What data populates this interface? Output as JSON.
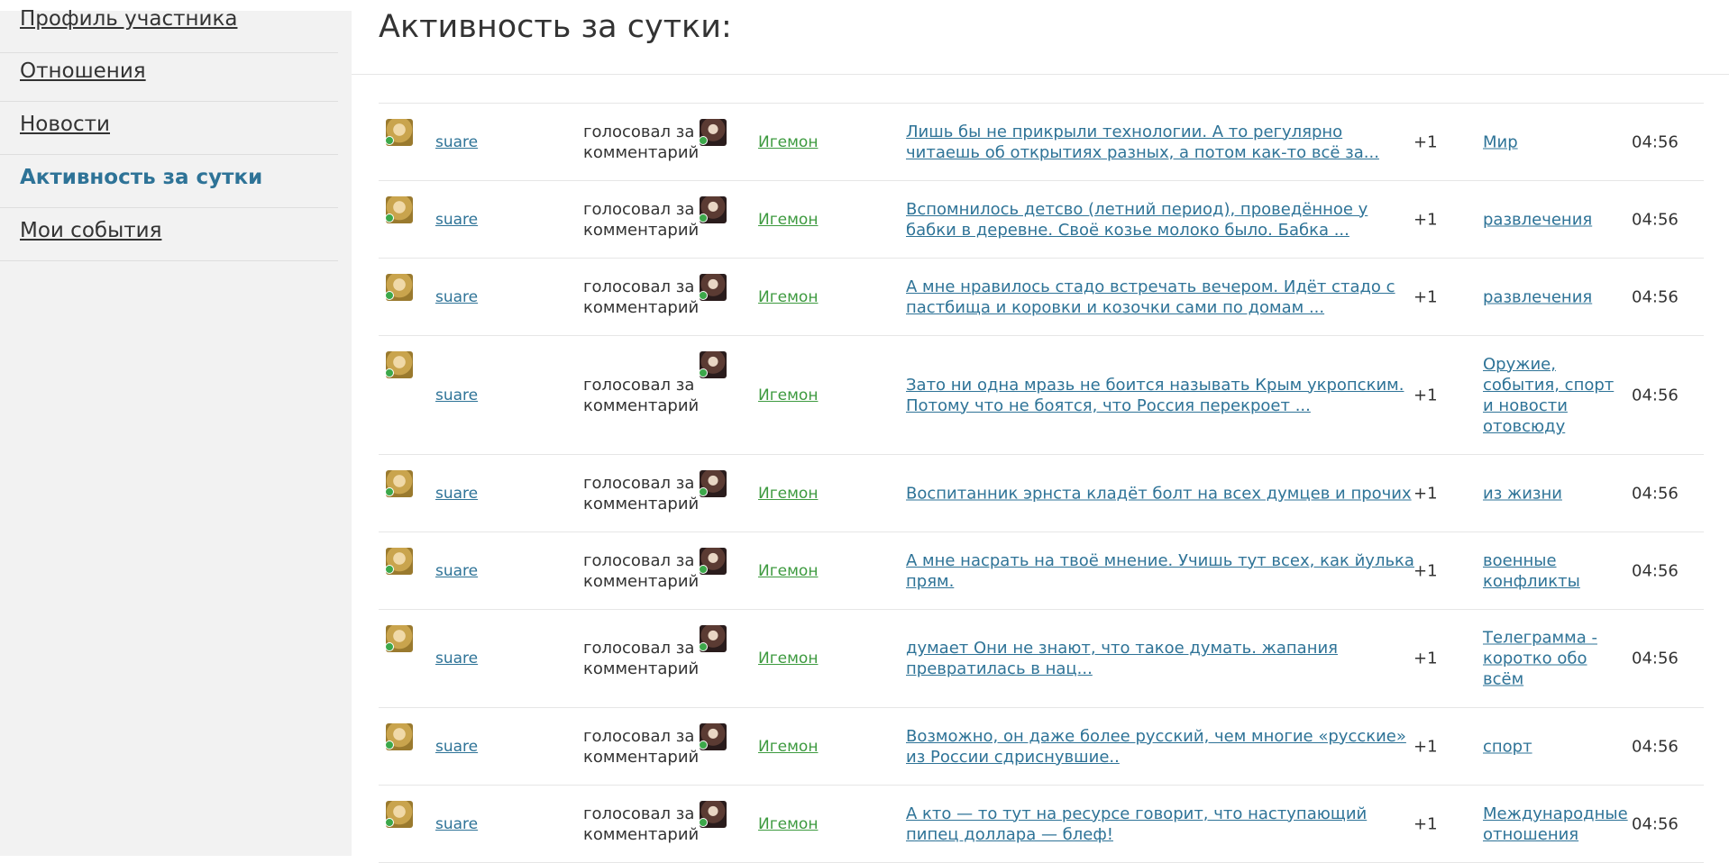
{
  "sidebar": {
    "items": [
      {
        "label": "Профиль участника",
        "active": false
      },
      {
        "label": "Отношения",
        "active": false
      },
      {
        "label": "Новости",
        "active": false
      },
      {
        "label": "Активность за сутки",
        "active": true
      },
      {
        "label": "Мои события",
        "active": false
      }
    ]
  },
  "main": {
    "title": "Активность за сутки:"
  },
  "activity": [
    {
      "user": "suare",
      "action": "голосовал за комментарий",
      "target": "Игемон",
      "comment": "Лишь бы не прикрыли технологии. А то регулярно читаешь об открытиях разных, а потом как-то всё за...",
      "score": "+1",
      "topic": "Мир",
      "time": "04:56"
    },
    {
      "user": "suare",
      "action": "голосовал за комментарий",
      "target": "Игемон",
      "comment": "Вспомнилось детсво (летний период), проведённое у бабки в деревне. Своё козье молоко было. Бабка ...",
      "score": "+1",
      "topic": "развлечения",
      "time": "04:56"
    },
    {
      "user": "suare",
      "action": "голосовал за комментарий",
      "target": "Игемон",
      "comment": "А мне нравилось стадо встречать вечером. Идёт стадо с пастбища и коровки и козочки сами по домам ...",
      "score": "+1",
      "topic": "развлечения",
      "time": "04:56"
    },
    {
      "user": "suare",
      "action": "голосовал за комментарий",
      "target": "Игемон",
      "comment": "Зато ни одна мразь не боится называть Крым укропским. Потому что не боятся, что Россия перекроет ...",
      "score": "+1",
      "topic": "Оружие, события, спорт и новости отовсюду",
      "time": "04:56"
    },
    {
      "user": "suare",
      "action": "голосовал за комментарий",
      "target": "Игемон",
      "comment": "Воспитанник эрнста кладёт болт на всех думцев и прочих",
      "score": "+1",
      "topic": "из жизни",
      "time": "04:56"
    },
    {
      "user": "suare",
      "action": "голосовал за комментарий",
      "target": "Игемон",
      "comment": "А мне насрать на твоё мнение. Учишь тут всех, как йулька прям.",
      "score": "+1",
      "topic": "военные конфликты",
      "time": "04:56"
    },
    {
      "user": "suare",
      "action": "голосовал за комментарий",
      "target": "Игемон",
      "comment": "думает Они не знают, что такое думать. жапания превратилась в нац...",
      "score": "+1",
      "topic": "Телеграмма - коротко обо всём",
      "time": "04:56"
    },
    {
      "user": "suare",
      "action": "голосовал за комментарий",
      "target": "Игемон",
      "comment": "Возможно, он даже более русский, чем многие «русские» из России сдриснувшие..",
      "score": "+1",
      "topic": "спорт",
      "time": "04:56"
    },
    {
      "user": "suare",
      "action": "голосовал за комментарий",
      "target": "Игемон",
      "comment": "А кто — то тут на ресурсе говорит, что наступающий пипец доллара — блеф!",
      "score": "+1",
      "topic": "Международные отношения",
      "time": "04:56"
    }
  ],
  "colors": {
    "link_blue": "#2e7397",
    "link_green": "#3d9a3f",
    "sidebar_bg": "#f2f2f2",
    "online_dot": "#3ca84a"
  }
}
